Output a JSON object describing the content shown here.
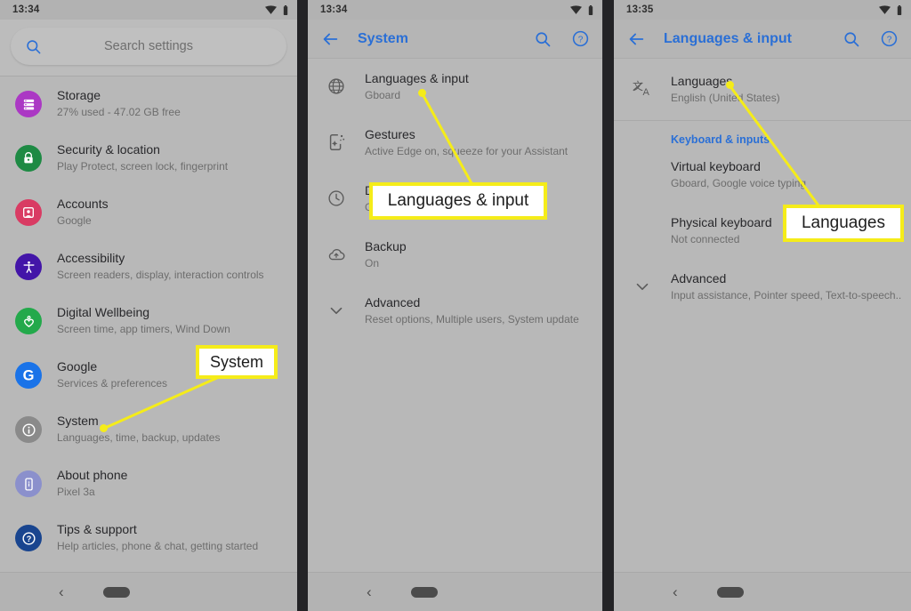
{
  "panels": [
    {
      "id": "settings-home",
      "statusbar": {
        "time": "13:34",
        "wifi_icon": "wifi-icon",
        "battery_icon": "battery-icon"
      },
      "search": {
        "placeholder": "Search settings",
        "icon": "search-icon"
      },
      "items": [
        {
          "title": "Storage",
          "subtitle": "27% used - 47.02 GB free",
          "icon": "storage-icon",
          "color": "#ab38c4"
        },
        {
          "title": "Security & location",
          "subtitle": "Play Protect, screen lock, fingerprint",
          "icon": "lock-icon",
          "color": "#1e8a44"
        },
        {
          "title": "Accounts",
          "subtitle": "Google",
          "icon": "account-icon",
          "color": "#d93b63"
        },
        {
          "title": "Accessibility",
          "subtitle": "Screen readers, display, interaction controls",
          "icon": "accessibility-icon",
          "color": "#4315a8"
        },
        {
          "title": "Digital Wellbeing",
          "subtitle": "Screen time, app timers, Wind Down",
          "icon": "heart-icon",
          "color": "#23a94b"
        },
        {
          "title": "Google",
          "subtitle": "Services & preferences",
          "icon": "google-g-icon",
          "color": "#1a73e8"
        },
        {
          "title": "System",
          "subtitle": "Languages, time, backup, updates",
          "icon": "info-icon",
          "color": "#8a8a8a"
        },
        {
          "title": "About phone",
          "subtitle": "Pixel 3a",
          "icon": "phone-info-icon",
          "color": "#8b90cc"
        },
        {
          "title": "Tips & support",
          "subtitle": "Help articles, phone & chat, getting started",
          "icon": "question-icon",
          "color": "#19458f"
        }
      ],
      "navbar": {
        "back_icon": "back-chevron-icon",
        "home_pill": "home-pill"
      }
    },
    {
      "id": "system",
      "statusbar": {
        "time": "13:34",
        "wifi_icon": "wifi-icon",
        "battery_icon": "battery-icon"
      },
      "appbar": {
        "back_icon": "back-arrow-icon",
        "title": "System",
        "search_icon": "search-icon",
        "help_icon": "help-icon"
      },
      "items": [
        {
          "title": "Languages & input",
          "subtitle": "Gboard",
          "icon": "globe-icon"
        },
        {
          "title": "Gestures",
          "subtitle": "Active Edge on, squeeze for your Assistant",
          "icon": "gestures-icon"
        },
        {
          "title": "D",
          "subtitle": "G",
          "icon": "clock-icon"
        },
        {
          "title": "Backup",
          "subtitle": "On",
          "icon": "cloud-upload-icon"
        },
        {
          "title": "Advanced",
          "subtitle": "Reset options, Multiple users, System update",
          "icon": "chevron-down-icon"
        }
      ],
      "navbar": {
        "back_icon": "back-chevron-icon",
        "home_pill": "home-pill"
      }
    },
    {
      "id": "languages-and-input",
      "statusbar": {
        "time": "13:35",
        "wifi_icon": "wifi-icon",
        "battery_icon": "battery-icon"
      },
      "appbar": {
        "back_icon": "back-arrow-icon",
        "title": "Languages & input",
        "search_icon": "search-icon",
        "help_icon": "help-icon"
      },
      "first_item": {
        "title": "Languages",
        "subtitle": "English (United States)",
        "icon": "translate-icon"
      },
      "section_header": "Keyboard & inputs",
      "items": [
        {
          "title": "Virtual keyboard",
          "subtitle": "Gboard, Google voice typing"
        },
        {
          "title": "Physical keyboard",
          "subtitle": "Not connected"
        }
      ],
      "advanced": {
        "title": "Advanced",
        "subtitle": "Input assistance, Pointer speed, Text-to-speech..",
        "icon": "chevron-down-icon"
      },
      "navbar": {
        "back_icon": "back-chevron-icon",
        "home_pill": "home-pill"
      }
    }
  ],
  "callouts": [
    {
      "id": "system",
      "label": "System"
    },
    {
      "id": "languages-input",
      "label": "Languages & input"
    },
    {
      "id": "languages",
      "label": "Languages"
    }
  ],
  "colors": {
    "highlight": "#f5ec19",
    "accent_blue": "#2a6fd6",
    "panel_bg": "#b8b8b8",
    "divider": "#232326"
  }
}
